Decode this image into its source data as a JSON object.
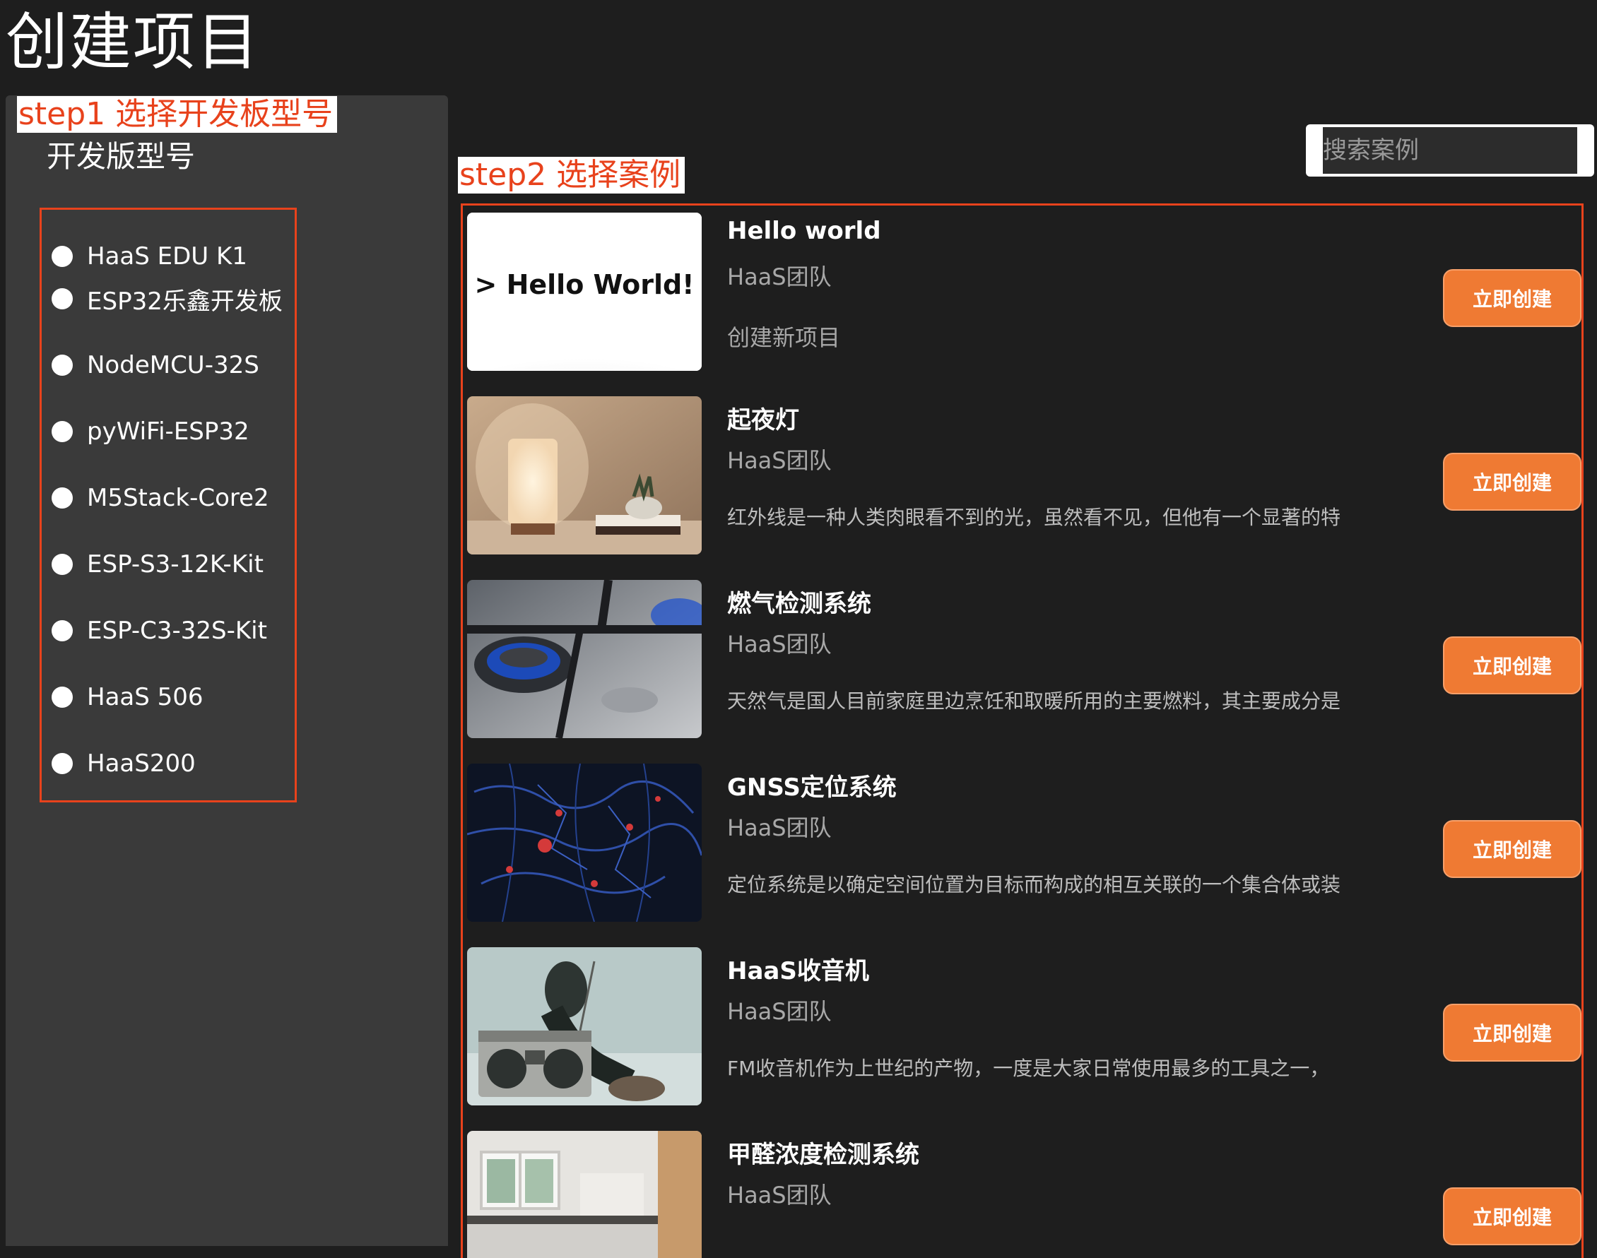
{
  "page": {
    "title": "创建项目"
  },
  "steps": {
    "step1": "step1 选择开发板型号",
    "step2": "step2 选择案例"
  },
  "boards": {
    "label": "开发版型号",
    "items": [
      "HaaS EDU K1",
      "ESP32乐鑫开发板",
      "NodeMCU-32S",
      "pyWiFi-ESP32",
      "M5Stack-Core2",
      "ESP-S3-12K-Kit",
      "ESP-C3-32S-Kit",
      "HaaS 506",
      "HaaS200"
    ]
  },
  "search": {
    "placeholder": "搜索案例"
  },
  "cases": [
    {
      "title": "Hello world",
      "author": "HaaS团队",
      "description": "创建新项目",
      "button": "立即创建",
      "thumb_text": "> Hello World!",
      "thumb_icon": "hello-world-thumbnail"
    },
    {
      "title": "起夜灯",
      "author": "HaaS团队",
      "description": "红外线是一种人类肉眼看不到的光，虽然看不见，但他有一个显著的特",
      "button": "立即创建",
      "thumb_icon": "night-lamp-photo"
    },
    {
      "title": "燃气检测系统",
      "author": "HaaS团队",
      "description": "天然气是国人目前家庭里边烹饪和取暖所用的主要燃料，其主要成分是",
      "button": "立即创建",
      "thumb_icon": "gas-stove-photo"
    },
    {
      "title": "GNSS定位系统",
      "author": "HaaS团队",
      "description": "定位系统是以确定空间位置为目标而构成的相互关联的一个集合体或装",
      "button": "立即创建",
      "thumb_icon": "map-photo"
    },
    {
      "title": "HaaS收音机",
      "author": "HaaS团队",
      "description": "FM收音机作为上世纪的产物，一度是大家日常使用最多的工具之一，",
      "button": "立即创建",
      "thumb_icon": "radio-photo"
    },
    {
      "title": "甲醛浓度检测系统",
      "author": "HaaS团队",
      "description": "",
      "button": "立即创建",
      "thumb_icon": "room-photo"
    }
  ],
  "colors": {
    "background": "#1e1e1e",
    "panel": "#3a3a3a",
    "annotation_red": "#e8421c",
    "button_orange": "#ef7a33"
  }
}
